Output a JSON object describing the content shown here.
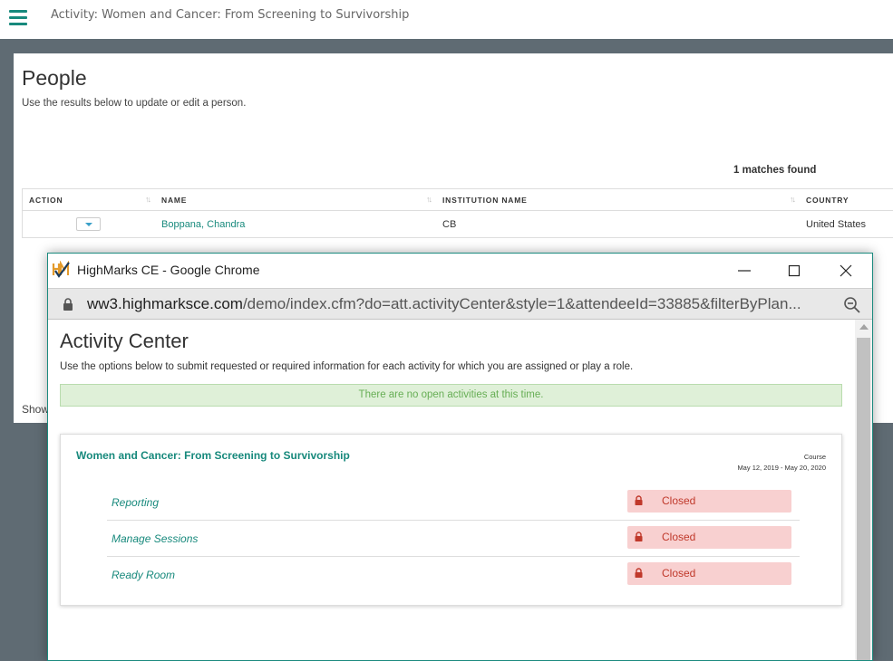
{
  "topbar": {
    "title": "Activity: Women and Cancer: From Screening to Survivorship"
  },
  "people": {
    "title": "People",
    "subtitle": "Use the results below to update or edit a person.",
    "matches": "1 matches found",
    "columns": [
      "ACTION",
      "NAME",
      "INSTITUTION NAME",
      "COUNTRY"
    ],
    "rows": [
      {
        "name": "Boppana, Chandra",
        "institution": "CB",
        "country": "United States"
      }
    ],
    "show_label": "Show"
  },
  "browser": {
    "window_title": "HighMarks CE - Google Chrome",
    "url_host": "ww3.highmarksce.com",
    "url_path": "/demo/index.cfm?do=att.activityCenter&style=1&attendeeId=33885&filterByPlan..."
  },
  "activity_center": {
    "title": "Activity Center",
    "subtitle": "Use the options below to submit requested or required information for each activity for which you are assigned or play a role.",
    "alert": "There are no open activities at this time.",
    "course": {
      "title": "Women and Cancer: From Screening to Survivorship",
      "type": "Course",
      "dates": "May 12, 2019 - May 20, 2020",
      "activities": [
        {
          "label": "Reporting",
          "status": "Closed"
        },
        {
          "label": "Manage Sessions",
          "status": "Closed"
        },
        {
          "label": "Ready Room",
          "status": "Closed"
        }
      ]
    }
  },
  "colors": {
    "accent": "#17897c",
    "alert_bg": "#dff0d8",
    "alert_text": "#67ae55",
    "closed_bg": "#f8d0d0",
    "closed_text": "#c0392b"
  }
}
